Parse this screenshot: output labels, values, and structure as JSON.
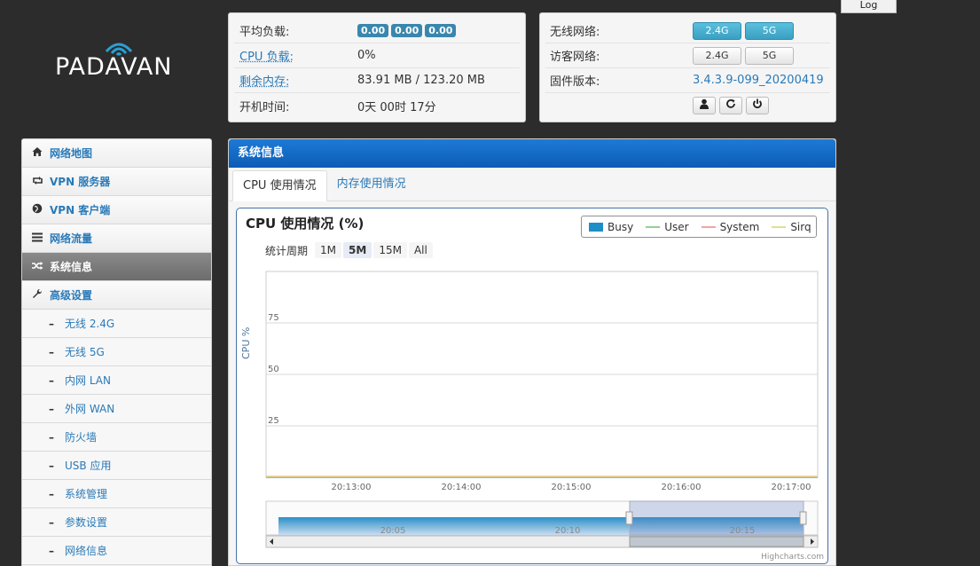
{
  "logo": {
    "text": "PADAVAN"
  },
  "log_button": "Log",
  "status_panel": {
    "rows": [
      {
        "label": "平均负载:",
        "loads": [
          "0.00",
          "0.00",
          "0.00"
        ]
      },
      {
        "label": "CPU 负载:",
        "value": "0%"
      },
      {
        "label": "剩余内存:",
        "value": "83.91 MB / 123.20 MB"
      },
      {
        "label": "开机时间:",
        "value": "0天 00时 17分"
      }
    ]
  },
  "wireless_panel": {
    "wireless_label": "无线网络:",
    "guest_label": "访客网络:",
    "firmware_label": "固件版本:",
    "firmware_value": "3.4.3.9-099_20200419",
    "btn_24g": "2.4G",
    "btn_5g": "5G"
  },
  "sidebar": {
    "items": [
      {
        "label": "网络地图",
        "icon": "home-icon"
      },
      {
        "label": "VPN 服务器",
        "icon": "retweet-icon"
      },
      {
        "label": "VPN 客户端",
        "icon": "globe-icon"
      },
      {
        "label": "网络流量",
        "icon": "list-icon"
      },
      {
        "label": "系统信息",
        "icon": "random-icon"
      },
      {
        "label": "高级设置",
        "icon": "wrench-icon"
      },
      {
        "label": "无线 2.4G"
      },
      {
        "label": "无线 5G"
      },
      {
        "label": "内网 LAN"
      },
      {
        "label": "外网 WAN"
      },
      {
        "label": "防火墙"
      },
      {
        "label": "USB 应用"
      },
      {
        "label": "系统管理"
      },
      {
        "label": "参数设置"
      },
      {
        "label": "网络信息"
      }
    ]
  },
  "main": {
    "header": "系统信息",
    "tabs": [
      "CPU 使用情况",
      "内存使用情况"
    ],
    "chart_title": "CPU 使用情况 (%)",
    "period_label": "统计周期",
    "periods": [
      "1M",
      "5M",
      "15M",
      "All"
    ],
    "selected_period": "5M",
    "credit": "Highcharts.com"
  },
  "colors": {
    "busy": "#1f8dc7",
    "user": "#90d090",
    "system": "#f4a3a3",
    "sirq": "#e0e090",
    "navigator": "#2a8fc8"
  },
  "chart_data": {
    "type": "area",
    "title": "CPU 使用情况 (%)",
    "ylabel": "CPU %",
    "ylim": [
      0,
      100
    ],
    "yticks": [
      "75",
      "50",
      "25"
    ],
    "x_ticks": [
      "20:13:00",
      "20:14:00",
      "20:15:00",
      "20:16:00",
      "20:17:00"
    ],
    "navigator_ticks": [
      "20:05",
      "20:10",
      "20:15"
    ],
    "series": [
      {
        "name": "Busy",
        "values": [
          0,
          0,
          0,
          0,
          0
        ]
      },
      {
        "name": "User",
        "values": [
          0,
          0,
          0,
          0,
          0
        ]
      },
      {
        "name": "System",
        "values": [
          0,
          0,
          0,
          0,
          0
        ]
      },
      {
        "name": "Sirq",
        "values": [
          0,
          0,
          0,
          0,
          0
        ]
      }
    ],
    "legend": "top-right",
    "grid": true
  }
}
